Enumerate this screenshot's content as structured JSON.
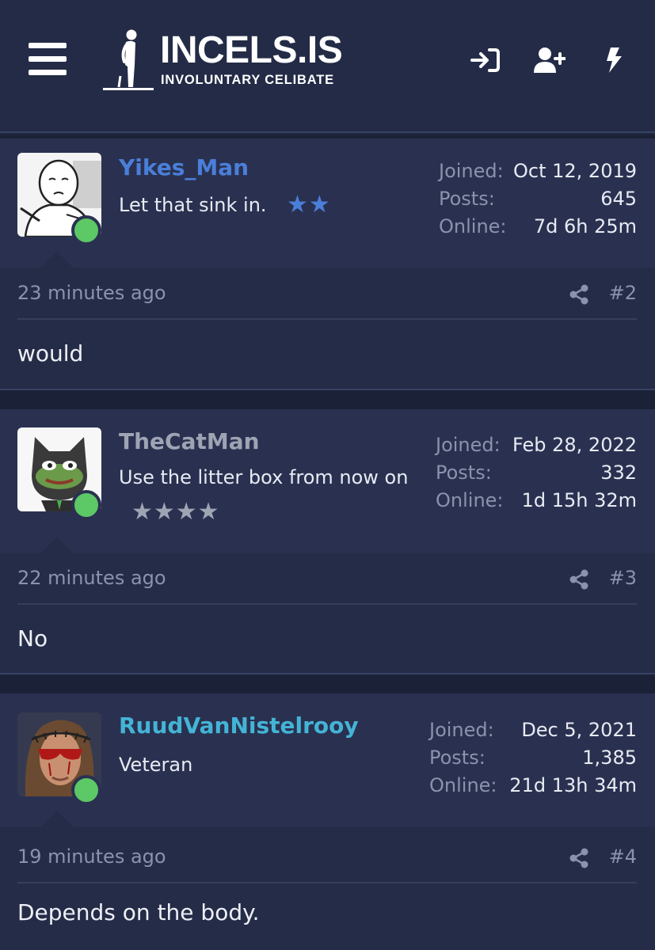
{
  "header": {
    "logo_title": "INCELS.IS",
    "logo_subtitle": "INVOLUNTARY CELIBATE",
    "icons": [
      "menu-icon",
      "login-icon",
      "register-icon",
      "bolt-icon"
    ]
  },
  "colors": {
    "background": "#202840",
    "user_panel": "#2a3150",
    "post_body": "#252c47",
    "online": "#5cc866",
    "username_1": "#4a7fd9",
    "username_2": "#9ea4b3",
    "username_3": "#44b4d6",
    "stars_blue": "#4a7fd9",
    "stars_gray": "#9ea4b3"
  },
  "stats_labels": {
    "joined": "Joined:",
    "posts": "Posts:",
    "online": "Online:"
  },
  "posts": [
    {
      "username": "Yikes_Man",
      "user_title": "Let that sink in.",
      "stars": "★★",
      "joined": "Oct 12, 2019",
      "post_count": "645",
      "online_time": "7d 6h 25m",
      "time": "23 minutes ago",
      "number": "#2",
      "text": "would"
    },
    {
      "username": "TheCatMan",
      "user_title": "Use the litter box from now on",
      "stars": "★★★★",
      "joined": "Feb 28, 2022",
      "post_count": "332",
      "online_time": "1d 15h 32m",
      "time": "22 minutes ago",
      "number": "#3",
      "text": "No"
    },
    {
      "username": "RuudVanNistelrooy",
      "user_title": "Veteran",
      "stars": "",
      "joined": "Dec 5, 2021",
      "post_count": "1,385",
      "online_time": "21d 13h 34m",
      "time": "19 minutes ago",
      "number": "#4",
      "text": "Depends on the body."
    }
  ]
}
